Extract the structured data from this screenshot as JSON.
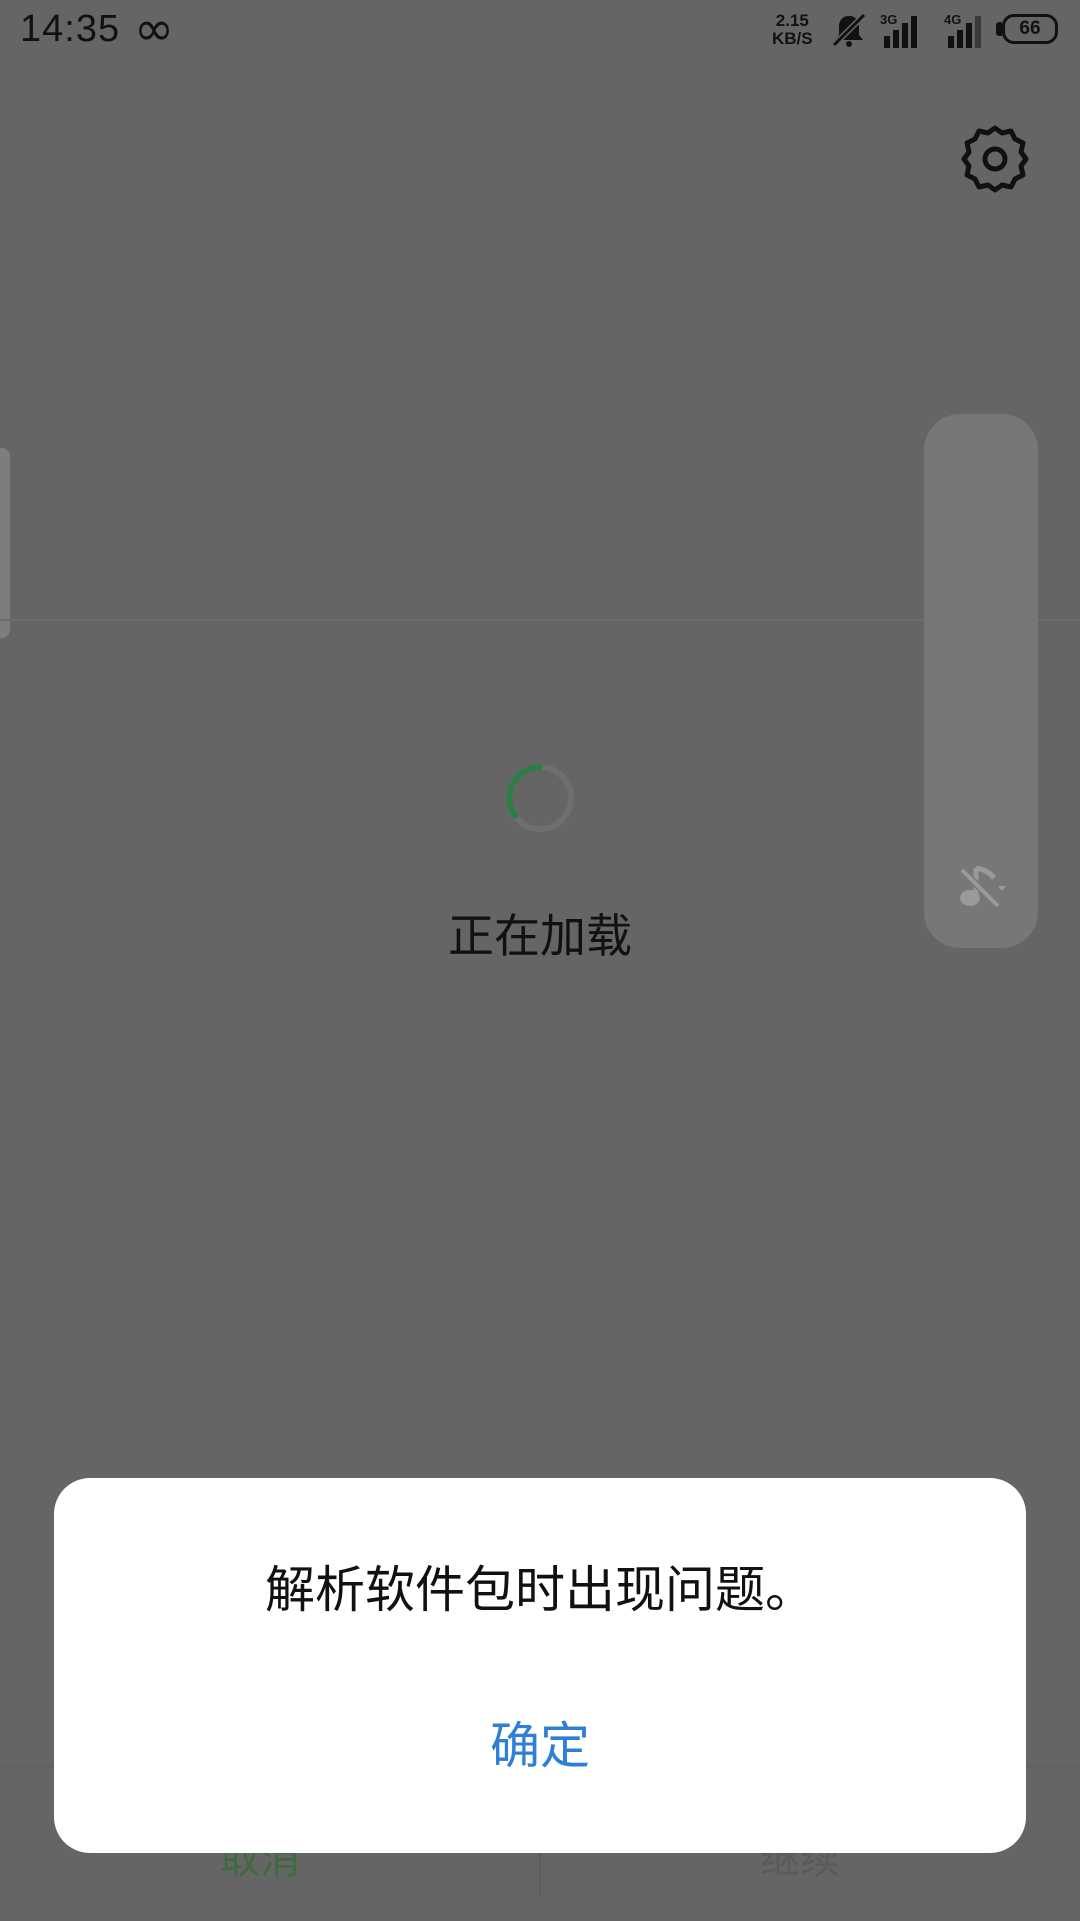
{
  "status_bar": {
    "time": "14:35",
    "infinity": "∞",
    "speed_value": "2.15",
    "speed_unit": "KB/S",
    "network1": "3G",
    "network2": "4G",
    "battery": "66"
  },
  "background": {
    "loading_text": "正在加载",
    "nav_left_label": "取消",
    "nav_right_label": "继续"
  },
  "dialog": {
    "message": "解析软件包时出现问题。",
    "confirm_label": "确定"
  },
  "colors": {
    "overlay_gray": "#656565",
    "accent_blue": "#2f7fd6",
    "spinner_green": "#2e7d46"
  }
}
